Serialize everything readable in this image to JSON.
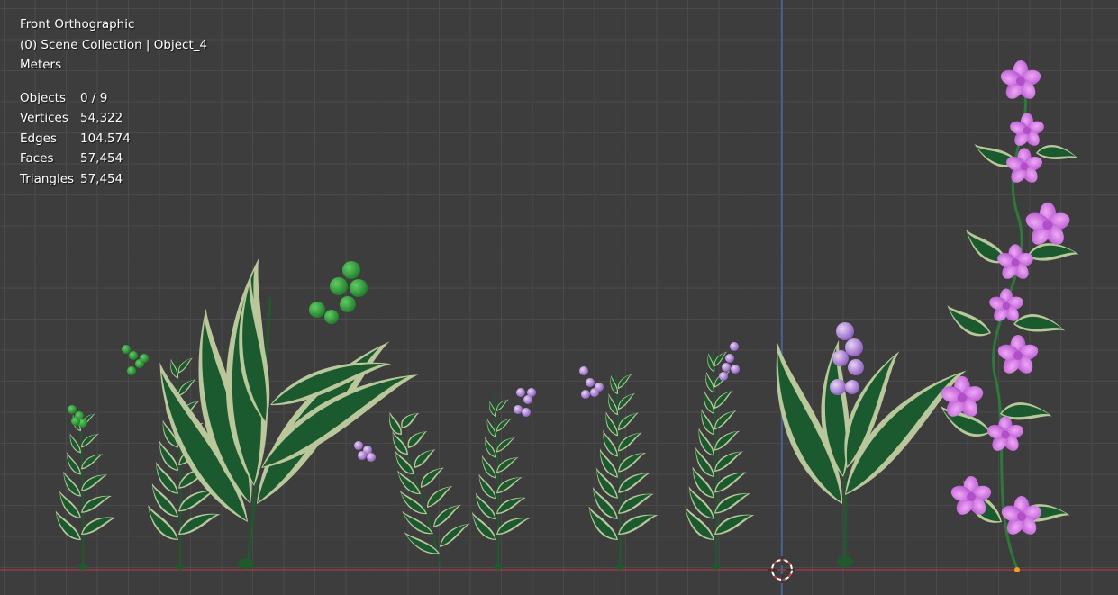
{
  "viewport": {
    "view_name": "Front Orthographic",
    "collection_info": "(0) Scene Collection | Object_4",
    "units": "Meters",
    "stats": [
      {
        "label": "Objects",
        "value": "0 / 9"
      },
      {
        "label": "Vertices",
        "value": "54,322"
      },
      {
        "label": "Edges",
        "value": "104,574"
      },
      {
        "label": "Faces",
        "value": "57,454"
      },
      {
        "label": "Triangles",
        "value": "57,454"
      }
    ]
  },
  "colors": {
    "background": "#3d3d3d",
    "grid": "#4a4a4a",
    "x_axis": "#b03a45",
    "z_axis": "#3f72c8",
    "leaf_dark": "#1b5a2e",
    "leaf_light": "#b9c79a",
    "berry_green": "#2f9b3b",
    "berry_purple": "#a77bd6",
    "flower_pink": "#d070e0"
  },
  "icons": {
    "cursor": "3d-cursor-icon"
  }
}
